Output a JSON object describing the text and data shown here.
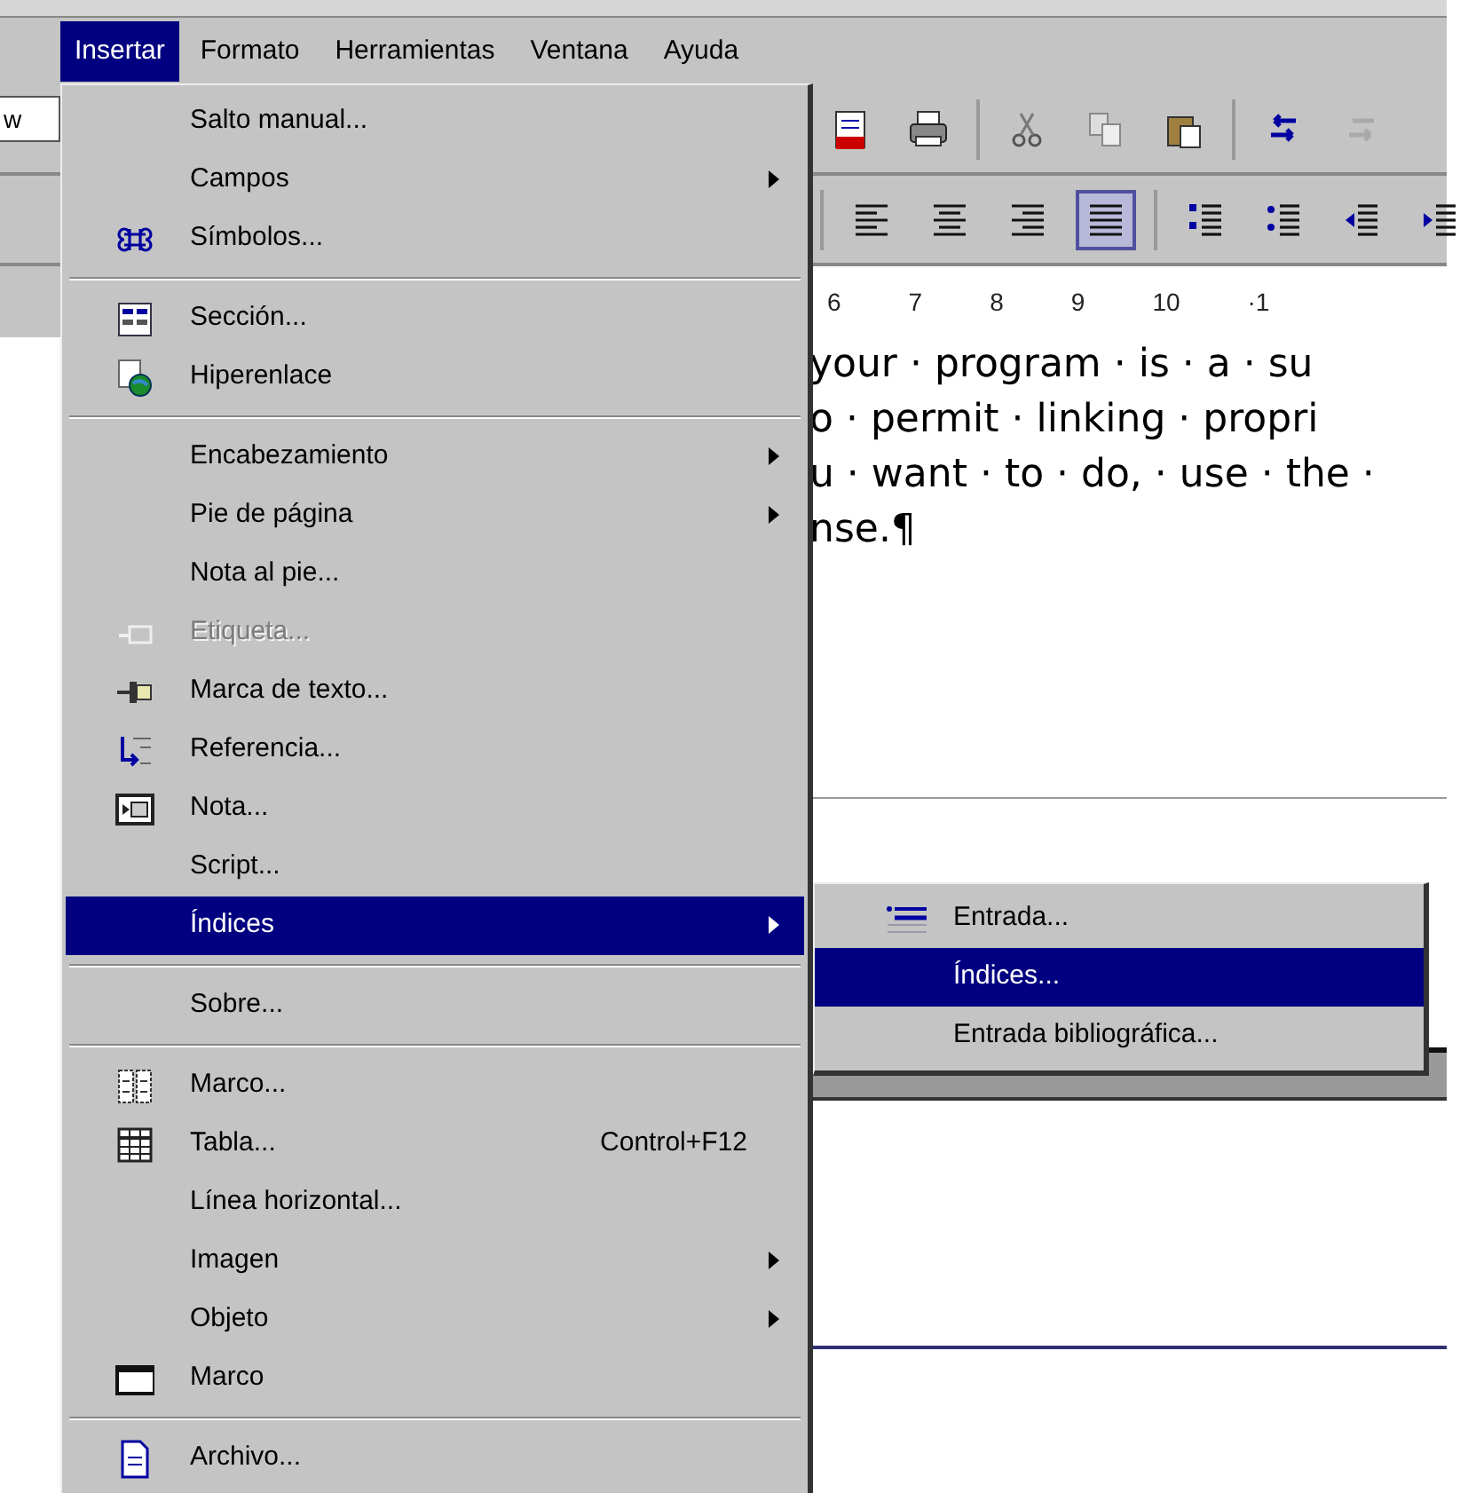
{
  "menubar": [
    {
      "label": "Insertar",
      "selected": true
    },
    {
      "label": "Formato",
      "selected": false
    },
    {
      "label": "Herramientas",
      "selected": false
    },
    {
      "label": "Ventana",
      "selected": false
    },
    {
      "label": "Ayuda",
      "selected": false
    }
  ],
  "toolbar_field": {
    "value": "w"
  },
  "alignment_buttons": [
    {
      "pressed": false
    },
    {
      "pressed": false
    },
    {
      "pressed": false
    },
    {
      "pressed": true
    }
  ],
  "ruler": [
    "6",
    "7",
    "8",
    "9",
    "10",
    "·1"
  ],
  "document_lines": [
    "your · program · is · a · su",
    "o · permit · linking · propri",
    "u · want · to · do, · use · the ·",
    "nse.¶"
  ],
  "menu": [
    {
      "kind": "item",
      "label": "Salto manual...",
      "has_submenu": false,
      "disabled": false,
      "selected": false
    },
    {
      "kind": "item",
      "label": "Campos",
      "has_submenu": true,
      "disabled": false,
      "selected": false
    },
    {
      "kind": "item",
      "label": "Símbolos...",
      "has_submenu": false,
      "disabled": false,
      "selected": false
    },
    {
      "kind": "separator"
    },
    {
      "kind": "item",
      "label": "Sección...",
      "has_submenu": false,
      "disabled": false,
      "selected": false
    },
    {
      "kind": "item",
      "label": "Hiperenlace",
      "has_submenu": false,
      "disabled": false,
      "selected": false
    },
    {
      "kind": "separator"
    },
    {
      "kind": "item",
      "label": "Encabezamiento",
      "has_submenu": true,
      "disabled": false,
      "selected": false
    },
    {
      "kind": "item",
      "label": "Pie de página",
      "has_submenu": true,
      "disabled": false,
      "selected": false
    },
    {
      "kind": "item",
      "label": "Nota al pie...",
      "has_submenu": false,
      "disabled": false,
      "selected": false
    },
    {
      "kind": "item",
      "label": "Etiqueta...",
      "has_submenu": false,
      "disabled": true,
      "selected": false
    },
    {
      "kind": "item",
      "label": "Marca de texto...",
      "has_submenu": false,
      "disabled": false,
      "selected": false
    },
    {
      "kind": "item",
      "label": "Referencia...",
      "has_submenu": false,
      "disabled": false,
      "selected": false
    },
    {
      "kind": "item",
      "label": "Nota...",
      "has_submenu": false,
      "disabled": false,
      "selected": false
    },
    {
      "kind": "item",
      "label": "Script...",
      "has_submenu": false,
      "disabled": false,
      "selected": false
    },
    {
      "kind": "item",
      "label": "Índices",
      "has_submenu": true,
      "disabled": false,
      "selected": true
    },
    {
      "kind": "separator"
    },
    {
      "kind": "item",
      "label": "Sobre...",
      "has_submenu": false,
      "disabled": false,
      "selected": false
    },
    {
      "kind": "separator"
    },
    {
      "kind": "item",
      "label": "Marco...",
      "has_submenu": false,
      "disabled": false,
      "selected": false
    },
    {
      "kind": "item",
      "label": "Tabla...",
      "shortcut": "Control+F12",
      "has_submenu": false,
      "disabled": false,
      "selected": false
    },
    {
      "kind": "item",
      "label": "Línea horizontal...",
      "has_submenu": false,
      "disabled": false,
      "selected": false
    },
    {
      "kind": "item",
      "label": "Imagen",
      "has_submenu": true,
      "disabled": false,
      "selected": false
    },
    {
      "kind": "item",
      "label": "Objeto",
      "has_submenu": true,
      "disabled": false,
      "selected": false
    },
    {
      "kind": "item",
      "label": "Marco",
      "has_submenu": false,
      "disabled": false,
      "selected": false
    },
    {
      "kind": "separator"
    },
    {
      "kind": "item",
      "label": "Archivo...",
      "has_submenu": false,
      "disabled": false,
      "selected": false
    }
  ],
  "submenu": [
    {
      "label": "Entrada...",
      "selected": false
    },
    {
      "label": "Índices...",
      "selected": true
    },
    {
      "label": "Entrada bibliográfica...",
      "selected": false
    }
  ]
}
